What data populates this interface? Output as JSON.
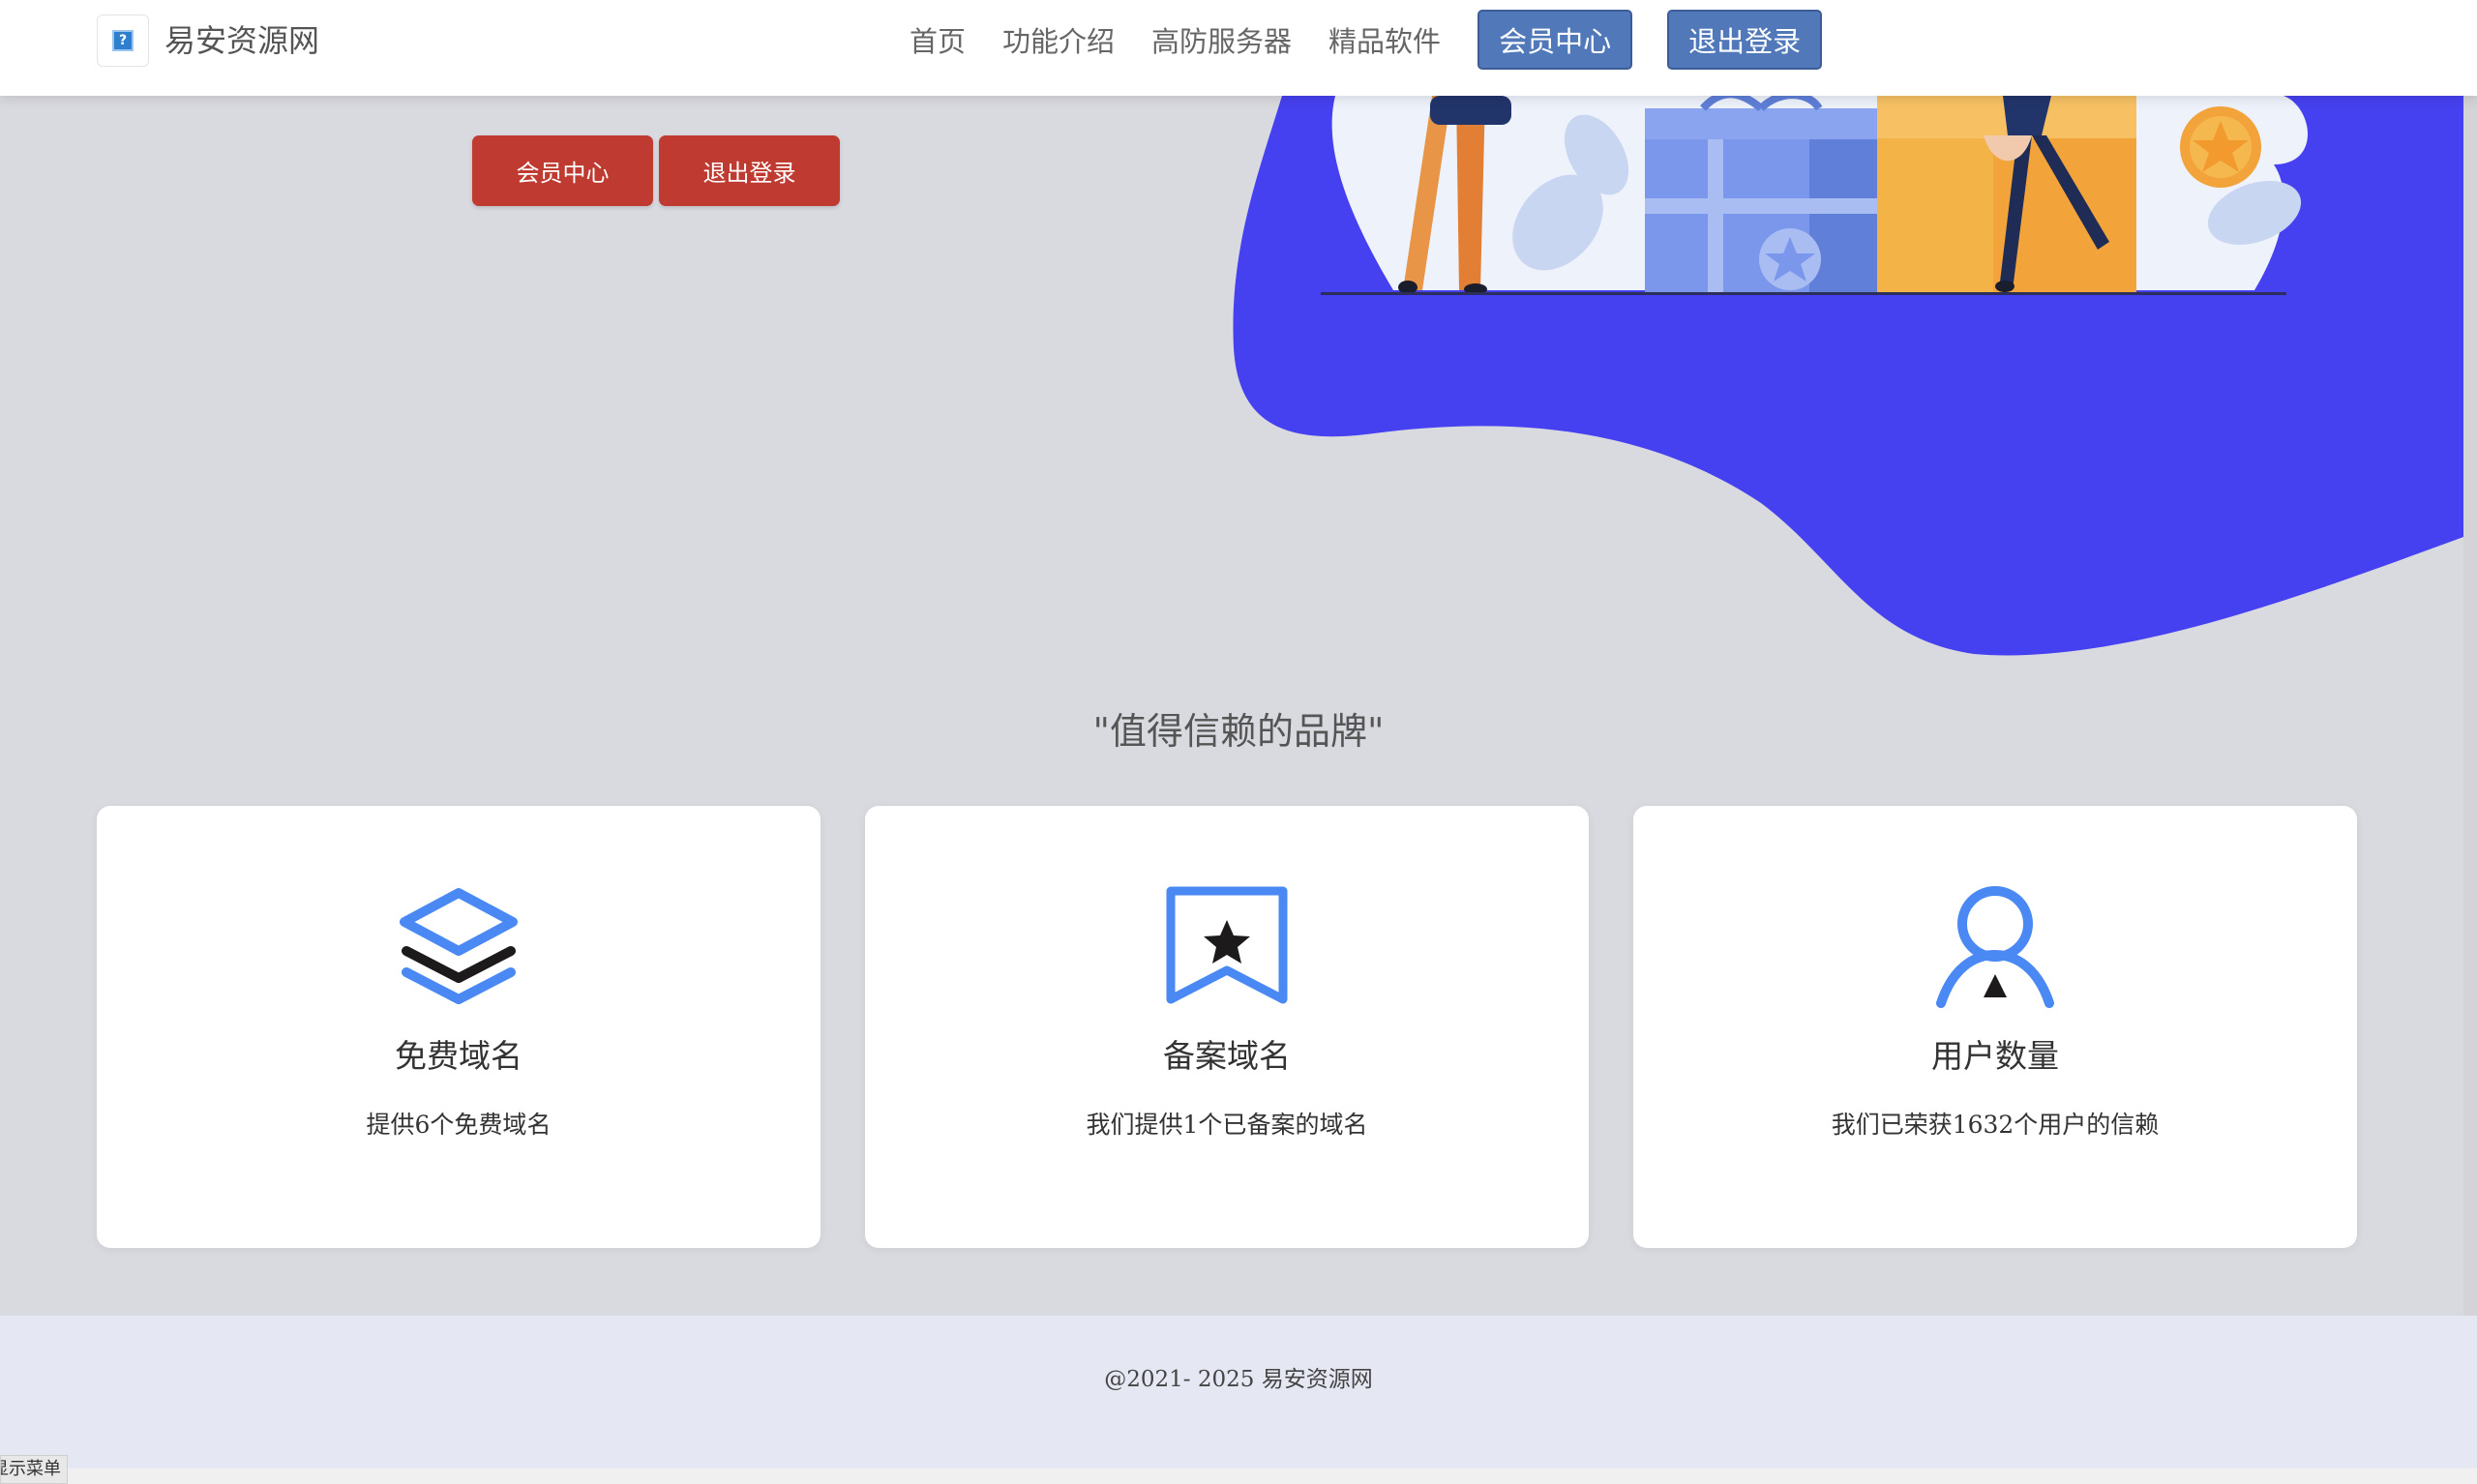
{
  "header": {
    "site_name": "易安资源网",
    "logo_glyph": "?",
    "nav": {
      "home": "首页",
      "features": "功能介绍",
      "servers": "高防服务器",
      "software": "精品软件",
      "member_center": "会员中心",
      "logout": "退出登录"
    }
  },
  "hero": {
    "member_center_button": "会员中心",
    "logout_button": "退出登录"
  },
  "section_title": "\"值得信赖的品牌\"",
  "features": [
    {
      "title": "免费域名",
      "description": "提供6个免费域名",
      "icon": "layers-icon"
    },
    {
      "title": "备案域名",
      "description": "我们提供1个已备案的域名",
      "icon": "bookmark-star-icon"
    },
    {
      "title": "用户数量",
      "description": "我们已荣获1632个用户的信赖",
      "icon": "user-icon"
    }
  ],
  "footer": {
    "copyright": "@2021- 2025 易安资源网"
  },
  "menu_toggle_label": "显示菜单",
  "colors": {
    "accent_blue": "#4a89f3",
    "hero_blob": "#4641f0",
    "red_button": "#bf3a30",
    "nav_button": "#5179b9"
  }
}
